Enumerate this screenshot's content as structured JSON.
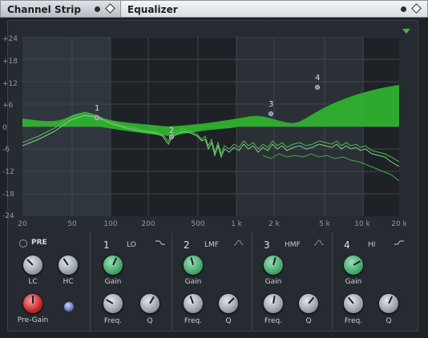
{
  "tabs": [
    {
      "label": "Channel Strip"
    },
    {
      "label": "Equalizer"
    }
  ],
  "graph": {
    "y_labels": [
      "+24",
      "+18",
      "+12",
      "+6",
      "0",
      "-6",
      "-12",
      "-18",
      "-24"
    ],
    "x_labels": [
      "20",
      "50",
      "100",
      "200",
      "500",
      "1 k",
      "2 k",
      "5 k",
      "10 k",
      "20 k"
    ],
    "band_markers": [
      "1",
      "2",
      "3",
      "4"
    ],
    "curve_color": "#2fb82f"
  },
  "pre": {
    "label": "PRE",
    "lc_label": "LC",
    "hc_label": "HC",
    "pregain_label": "Pre-Gain"
  },
  "bands": [
    {
      "number": "1",
      "name": "LO",
      "gain_label": "Gain",
      "freq_label": "Freq.",
      "q_label": "Q",
      "shape": "shelf"
    },
    {
      "number": "2",
      "name": "LMF",
      "gain_label": "Gain",
      "freq_label": "Freq.",
      "q_label": "Q",
      "shape": "peak"
    },
    {
      "number": "3",
      "name": "HMF",
      "gain_label": "Gain",
      "freq_label": "Freq.",
      "q_label": "Q",
      "shape": "peak"
    },
    {
      "number": "4",
      "name": "HI",
      "gain_label": "Gain",
      "freq_label": "Freq.",
      "q_label": "Q",
      "shape": "shelf"
    }
  ]
}
